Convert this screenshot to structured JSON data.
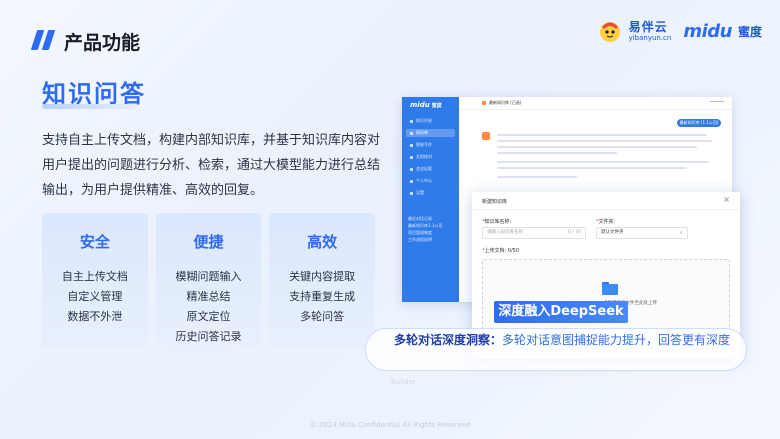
{
  "header": {
    "title": "产品功能"
  },
  "logos": {
    "yiban_main": "易伴云",
    "yiban_sub": "yibanyun.cn",
    "midu_word": "midu",
    "midu_cn": "蜜度"
  },
  "section": {
    "heading": "知识问答",
    "description": "支持自主上传文档，构建内部知识库，并基于知识库内容对用户提出的问题进行分析、检索，通过大模型能力进行总结输出，为用户提供精准、高效的回复。"
  },
  "cards": [
    {
      "title": "安全",
      "items": [
        "自主上传文档",
        "自定义管理",
        "数据不外泄"
      ]
    },
    {
      "title": "便捷",
      "items": [
        "模糊问题输入",
        "精准总结",
        "原文定位",
        "历史问答记录"
      ]
    },
    {
      "title": "高效",
      "items": [
        "关键内容提取",
        "支持重复生成",
        "多轮问答"
      ]
    }
  ],
  "app": {
    "logo": "midu",
    "logo_cn": "蜜度",
    "menu": [
      "知识问答",
      "知识库",
      "智能写作",
      "文档校对",
      "会议纪要",
      "个人中心",
      "设置"
    ],
    "recent_title": "最近对话记录",
    "recent": [
      "最新知识库1.1公司",
      "项目管理制度",
      "工作流程说明"
    ],
    "topbar_title": "最新知识库 (已选)",
    "doc_button": "最新知识库 (1.1公司)"
  },
  "modal": {
    "title": "新建知识库",
    "close": "×",
    "name_label": "知识库名称:",
    "name_placeholder": "请输入知识库名称",
    "name_count": "0 / 30",
    "folder_label": "文件夹:",
    "folder_value": "默认文件夹",
    "folder_chevron": "∨",
    "upload_label": "上传文档: 0/50",
    "upload_tip": "点击或拖拽文件至此处上传"
  },
  "deepseek_badge": "深度融入DeepSeek",
  "callout": {
    "bold": "多轮对话深度洞察：",
    "text": "多轮对话意图捕捉能力提升，回答更有深度"
  },
  "footer": {
    "copyright": "© 2024 Midu Confidential All Rights Reserved",
    "faint": "Builder"
  },
  "colors": {
    "accent": "#2f6bf2",
    "sidebar": "#2f7bea",
    "card_bg": "#dbe7fd"
  }
}
